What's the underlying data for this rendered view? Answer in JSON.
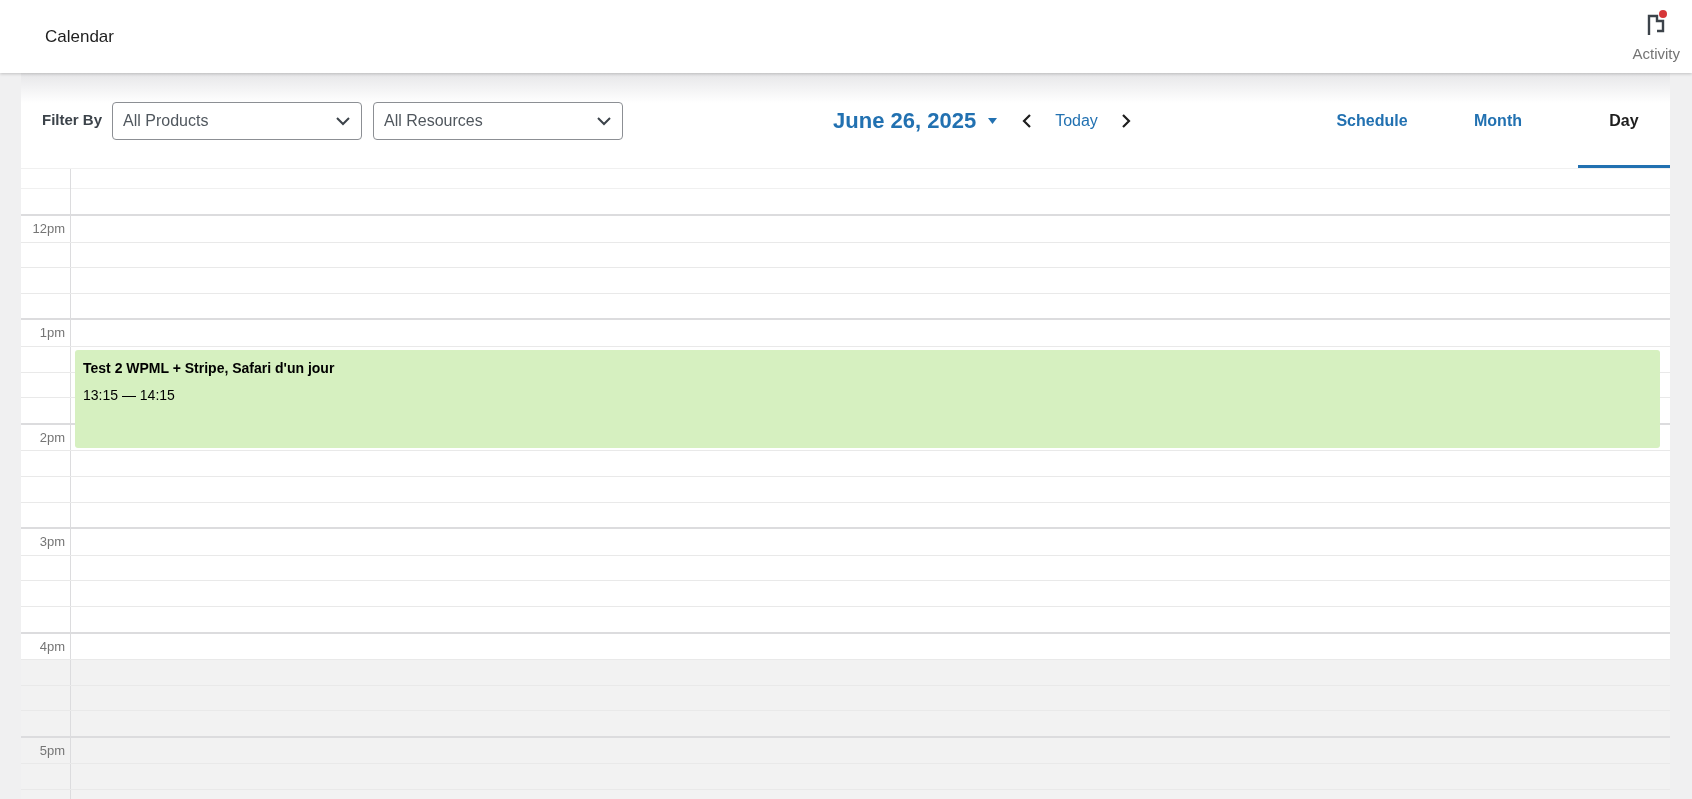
{
  "header": {
    "title": "Calendar",
    "activity": {
      "label": "Activity",
      "unread": true
    }
  },
  "filters": {
    "label": "Filter By",
    "selects": [
      {
        "value": "All Products"
      },
      {
        "value": "All Resources"
      }
    ]
  },
  "date_nav": {
    "date": "June 26, 2025",
    "today": "Today"
  },
  "views": [
    {
      "label": "Schedule",
      "selected": false
    },
    {
      "label": "Month",
      "selected": false
    },
    {
      "label": "Day",
      "selected": true
    }
  ],
  "hours": [
    {
      "label": "12pm",
      "slots": [
        {
          "available": true
        },
        {
          "available": true
        },
        {
          "available": true
        },
        {
          "available": true
        }
      ]
    },
    {
      "label": "1pm",
      "slots": [
        {
          "available": true
        },
        {
          "available": true,
          "event": {
            "title": "Test 2 WPML + Stripe, Safari d'un jour",
            "time": "13:15 — 14:15"
          }
        },
        {
          "available": true
        },
        {
          "available": true
        }
      ]
    },
    {
      "label": "2pm",
      "slots": [
        {
          "available": true
        },
        {
          "available": true
        },
        {
          "available": true
        },
        {
          "available": true
        }
      ]
    },
    {
      "label": "3pm",
      "slots": [
        {
          "available": true
        },
        {
          "available": true
        },
        {
          "available": true
        },
        {
          "available": true
        }
      ]
    },
    {
      "label": "4pm",
      "slots": [
        {
          "available": true
        },
        {
          "available": false
        },
        {
          "available": false
        },
        {
          "available": false
        }
      ]
    },
    {
      "label": "5pm",
      "slots": [
        {
          "available": false
        },
        {
          "available": false
        },
        {
          "available": false
        }
      ]
    }
  ]
}
